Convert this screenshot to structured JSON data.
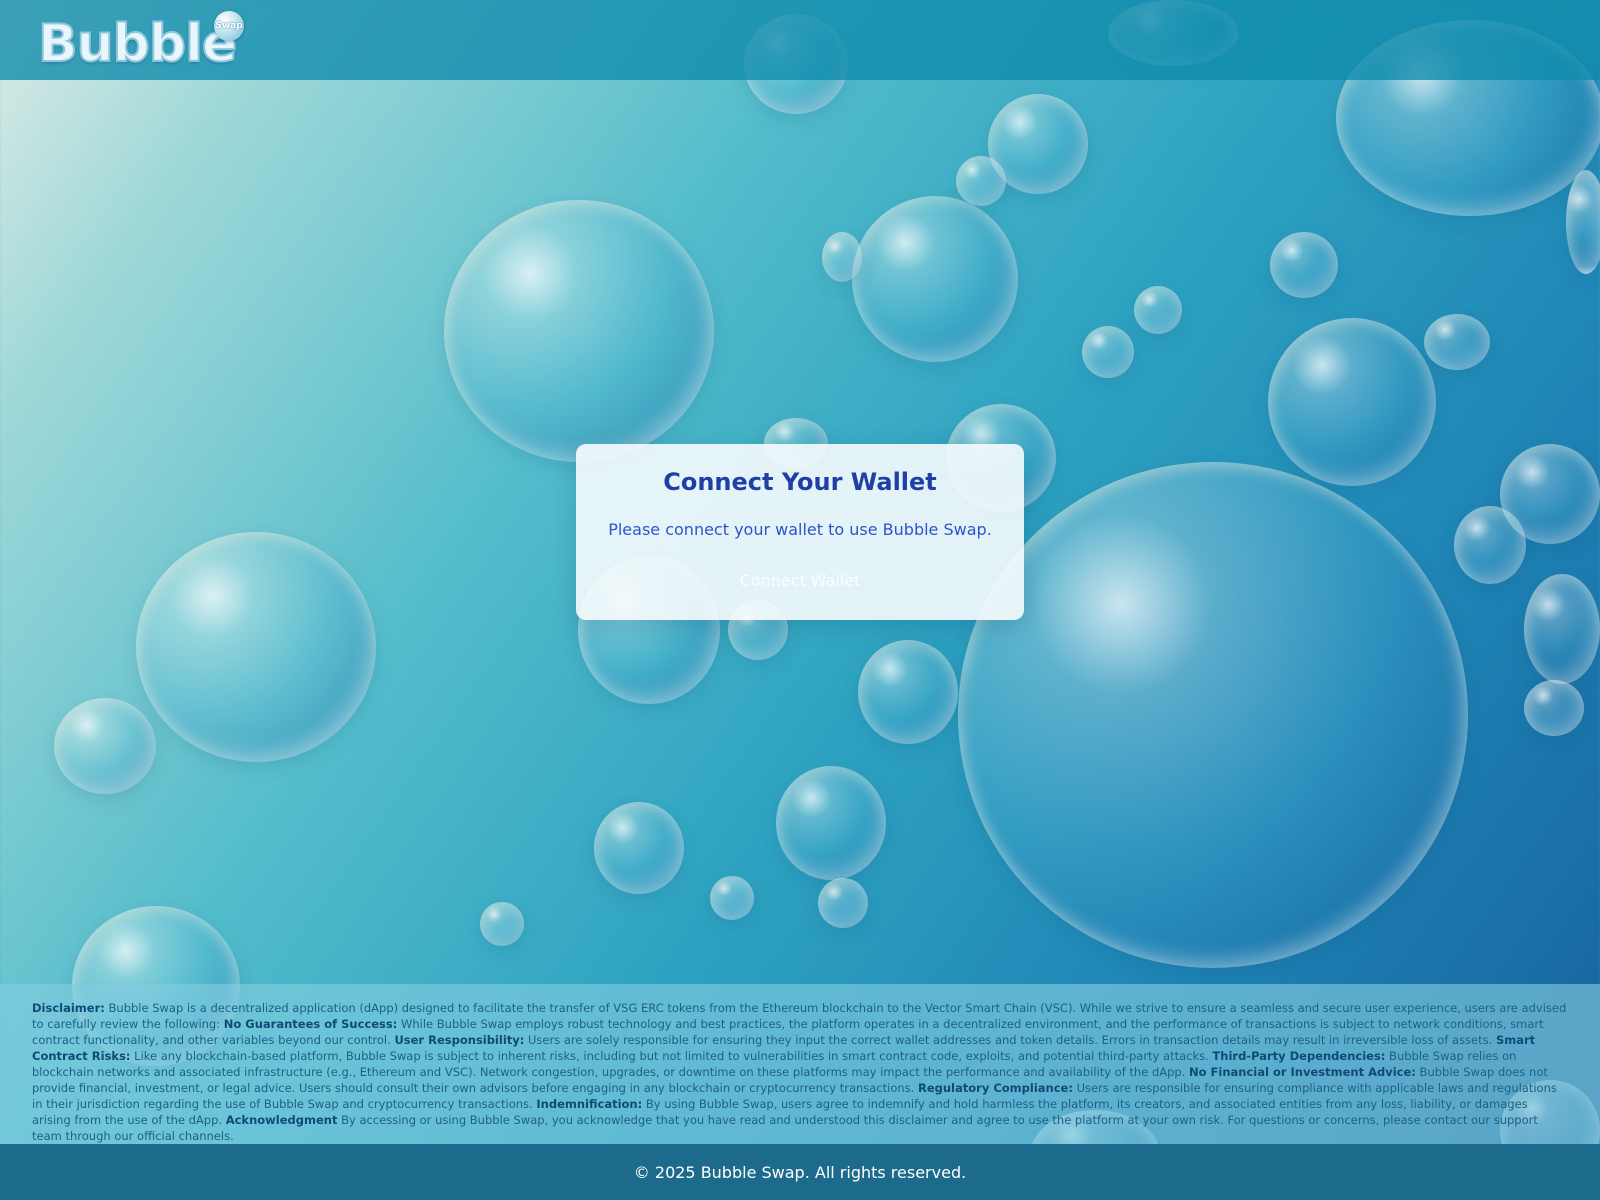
{
  "header": {
    "logo_word": "Bubble",
    "logo_badge": "Swap"
  },
  "card": {
    "title": "Connect Your Wallet",
    "text": "Please connect your wallet to use Bubble Swap.",
    "button_label": "Connect Wallet"
  },
  "disclaimer": [
    {
      "heading": "Disclaimer:",
      "text": " Bubble Swap is a decentralized application (dApp) designed to facilitate the transfer of VSG ERC tokens from the Ethereum blockchain to the Vector Smart Chain (VSC). While we strive to ensure a seamless and secure user experience, users are advised to carefully review the following: "
    },
    {
      "heading": "No Guarantees of Success:",
      "text": " While Bubble Swap employs robust technology and best practices, the platform operates in a decentralized environment, and the performance of transactions is subject to network conditions, smart contract functionality, and other variables beyond our control. "
    },
    {
      "heading": "User Responsibility:",
      "text": " Users are solely responsible for ensuring they input the correct wallet addresses and token details. Errors in transaction details may result in irreversible loss of assets. "
    },
    {
      "heading": "Smart Contract Risks:",
      "text": " Like any blockchain-based platform, Bubble Swap is subject to inherent risks, including but not limited to vulnerabilities in smart contract code, exploits, and potential third-party attacks. "
    },
    {
      "heading": "Third-Party Dependencies:",
      "text": " Bubble Swap relies on blockchain networks and associated infrastructure (e.g., Ethereum and VSC). Network congestion, upgrades, or downtime on these platforms may impact the performance and availability of the dApp. "
    },
    {
      "heading": "No Financial or Investment Advice:",
      "text": " Bubble Swap does not provide financial, investment, or legal advice. Users should consult their own advisors before engaging in any blockchain or cryptocurrency transactions. "
    },
    {
      "heading": "Regulatory Compliance:",
      "text": " Users are responsible for ensuring compliance with applicable laws and regulations in their jurisdiction regarding the use of Bubble Swap and cryptocurrency transactions. "
    },
    {
      "heading": "Indemnification:",
      "text": " By using Bubble Swap, users agree to indemnify and hold harmless the platform, its creators, and associated entities from any loss, liability, or damages arising from the use of the dApp. "
    },
    {
      "heading": "Acknowledgment",
      "text": " By accessing or using Bubble Swap, you acknowledge that you have read and understood this disclaimer and agree to use the platform at your own risk. For questions or concerns, please contact our support team through our official channels."
    }
  ],
  "footer": {
    "text": "© 2025 Bubble Swap. All rights reserved."
  },
  "colors": {
    "header_bg": "#108aac",
    "card_title": "#1f3fa6",
    "card_text": "#2c55cc",
    "footer_bg": "#1c6b8c"
  }
}
